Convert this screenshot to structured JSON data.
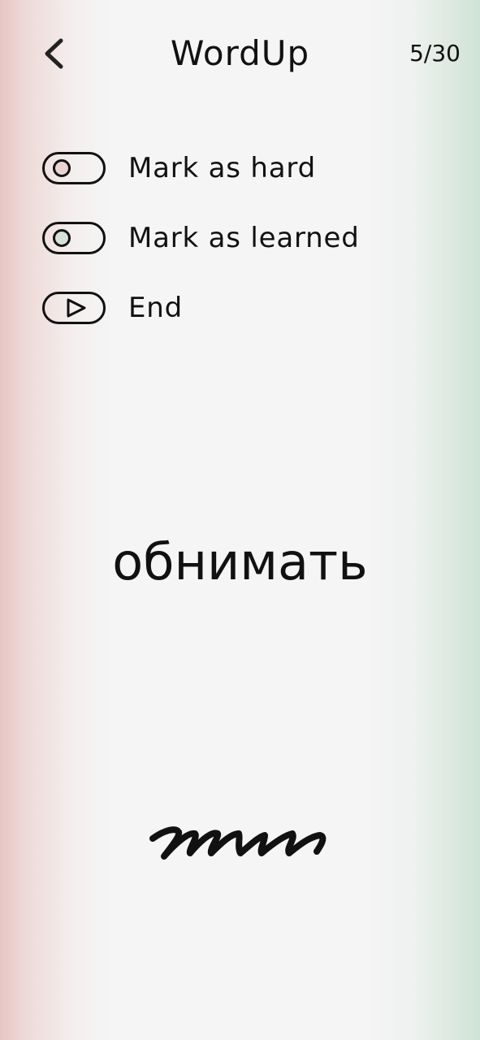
{
  "header": {
    "title": "WordUp",
    "back_icon": "chevron-left-icon",
    "progress": "5/30"
  },
  "options": [
    {
      "label": "Mark as hard",
      "icon": "toggle-icon",
      "knob_color": "#ecd3d1"
    },
    {
      "label": "Mark as learned",
      "icon": "toggle-icon",
      "knob_color": "#d6e1d8"
    },
    {
      "label": "End",
      "icon": "play-icon"
    }
  ],
  "card": {
    "word": "обнимать",
    "handwriting_icon": "handwriting-icon"
  },
  "colors": {
    "left_edge": "#e6c6c4",
    "right_edge": "#cfe3d6",
    "background": "#f5f5f5",
    "ink": "#111111"
  }
}
